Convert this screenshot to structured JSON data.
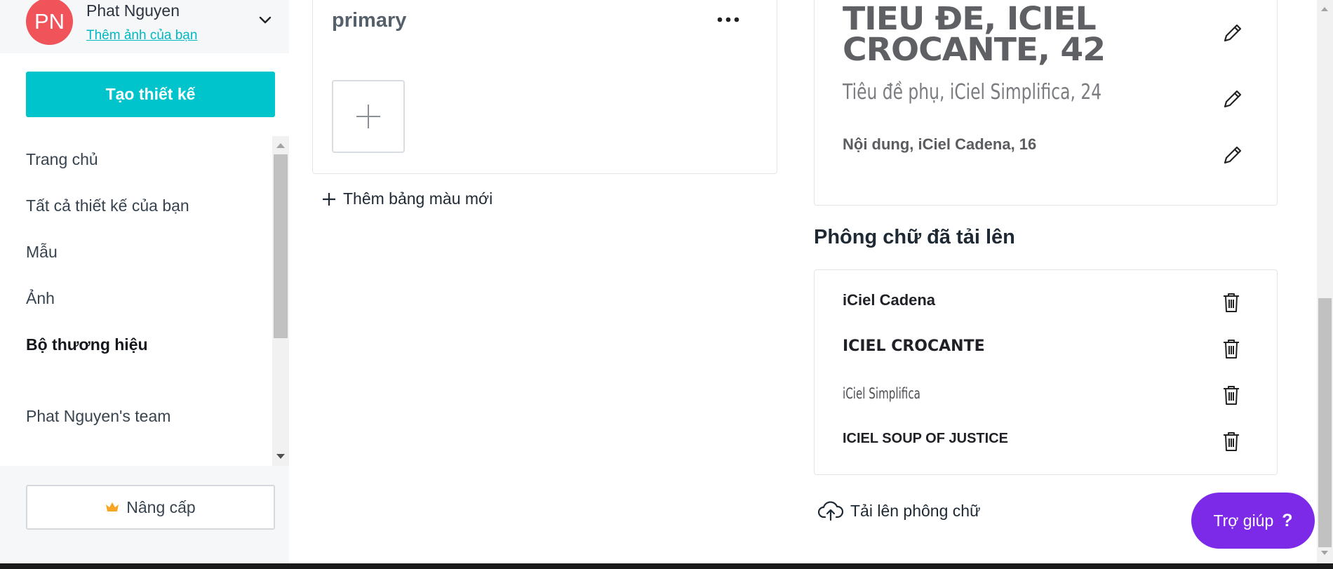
{
  "profile": {
    "initials": "PN",
    "name": "Phat Nguyen",
    "add_photo": "Thêm ảnh của bạn",
    "avatar_color": "#f0535a"
  },
  "sidebar": {
    "create_button": "Tạo thiết kế",
    "items": [
      {
        "label": "Trang chủ"
      },
      {
        "label": "Tất cả thiết kế của bạn"
      },
      {
        "label": "Mẫu"
      },
      {
        "label": "Ảnh"
      },
      {
        "label": "Bộ thương hiệu",
        "active": true
      },
      {
        "label": "Phat Nguyen's team"
      }
    ],
    "upgrade_button": "Nâng cấp"
  },
  "palette": {
    "title": "primary",
    "menu_icon": "more-dots-icon",
    "add_new": "Thêm bảng màu mới"
  },
  "brand_fonts": {
    "heading": "TIEU ĐE, ICIEL CROCANTE, 42",
    "subheading": "Tiêu đề phụ, iCiel Simplifica, 24",
    "body": "Nội dung, iCiel Cadena, 16"
  },
  "uploaded_fonts": {
    "title": "Phông chữ đã tải lên",
    "items": [
      "iCiel Cadena",
      "ICIEL CROCANTE",
      "iCiel Simplifica",
      "ICIEL SOUP OF JUSTICE"
    ],
    "upload_button": "Tải lên phông chữ"
  },
  "help": {
    "label": "Trợ giúp",
    "icon": "?"
  },
  "colors": {
    "accent": "#00c4cc",
    "help": "#7d2ae8",
    "link": "#00b8c4"
  }
}
